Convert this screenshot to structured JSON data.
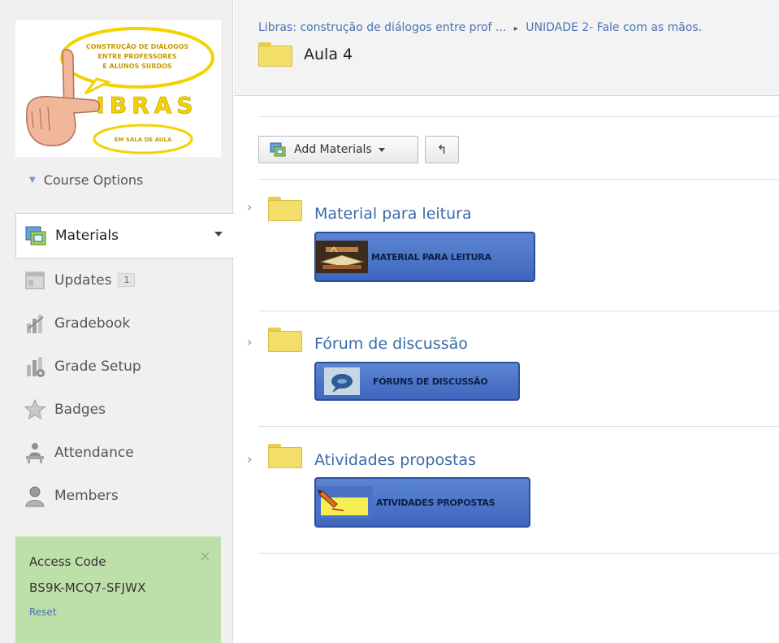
{
  "logo": {
    "speech_top": [
      "CONSTRUÇÃO DE DIÁLOGOS",
      "ENTRE PROFESSORES",
      "E ALUNOS SURDOS"
    ],
    "word": "IBRAS",
    "speech_bottom": "EM SALA DE AULA"
  },
  "sidebar": {
    "course_options": "Course Options",
    "items": [
      {
        "label": "Materials",
        "icon": "materials-icon"
      },
      {
        "label": "Updates",
        "icon": "updates-icon",
        "badge": "1"
      },
      {
        "label": "Gradebook",
        "icon": "gradebook-icon"
      },
      {
        "label": "Grade Setup",
        "icon": "grade-setup-icon"
      },
      {
        "label": "Badges",
        "icon": "badge-star-icon"
      },
      {
        "label": "Attendance",
        "icon": "attendance-icon"
      },
      {
        "label": "Members",
        "icon": "members-icon"
      }
    ],
    "access": {
      "title": "Access Code",
      "code": "BS9K-MCQ7-SFJWX",
      "reset": "Reset",
      "close": "×"
    }
  },
  "header": {
    "breadcrumb": [
      "Libras: construção de diálogos entre prof ...",
      "UNIDADE 2- Fale com as mãos."
    ],
    "breadcrumb_sep": "▸",
    "title": "Aula 4"
  },
  "toolbar": {
    "add_label": "Add Materials",
    "undo_glyph": "↰"
  },
  "materials": [
    {
      "title": "Material para leitura",
      "banner": "MATERIAL PARA LEITURA",
      "chevron": "›"
    },
    {
      "title": "Fórum de discussão",
      "banner": "FÓRUNS DE DISCUSSÃO",
      "chevron": "›"
    },
    {
      "title": "Atividades propostas",
      "banner": "ATIVIDADES PROPOSTAS",
      "chevron": "›"
    }
  ],
  "colors": {
    "link": "#3a6aa8",
    "access_bg": "#bde0a8",
    "banner_blue": "#4a72c6",
    "folder_yellow": "#f4de6a"
  }
}
